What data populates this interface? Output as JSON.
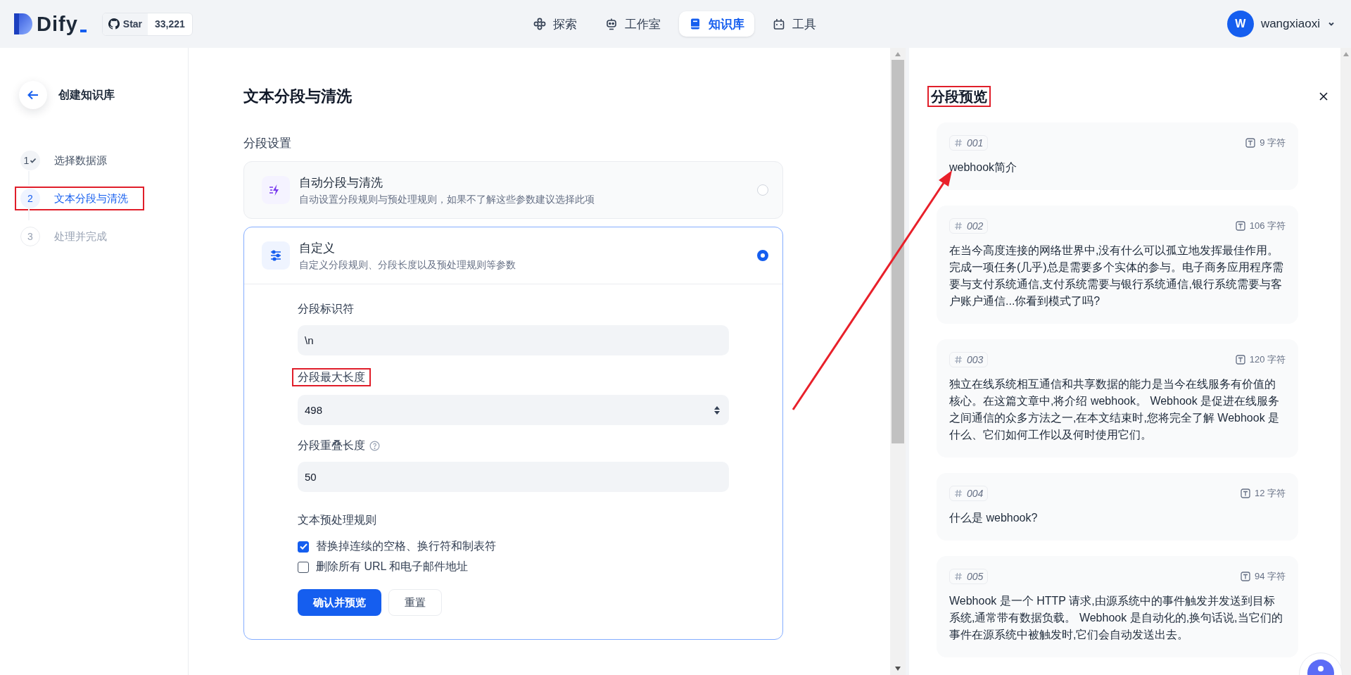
{
  "header": {
    "logo": "Dify",
    "github": {
      "label": "Star",
      "count": "33,221"
    },
    "nav": [
      {
        "kind": "explore",
        "label": "探索",
        "selected": false
      },
      {
        "kind": "studio",
        "label": "工作室",
        "selected": false
      },
      {
        "kind": "knowledge",
        "label": "知识库",
        "selected": true
      },
      {
        "kind": "tools",
        "label": "工具",
        "selected": false
      }
    ],
    "user": {
      "initial": "W",
      "name": "wangxiaoxi"
    }
  },
  "sidebar": {
    "title": "创建知识库",
    "steps": [
      {
        "number": "1",
        "label": "选择数据源",
        "done": true,
        "selected": false,
        "highlighted": false
      },
      {
        "number": "2",
        "label": "文本分段与清洗",
        "done": false,
        "selected": true,
        "highlighted": true
      },
      {
        "number": "3",
        "label": "处理并完成",
        "done": false,
        "selected": false,
        "highlighted": false
      }
    ]
  },
  "settings": {
    "title": "文本分段与清洗",
    "section": "分段设置",
    "modes": [
      {
        "kind": "auto",
        "title": "自动分段与清洗",
        "description": "自动设置分段规则与预处理规则，如果不了解这些参数建议选择此项",
        "selected": false,
        "expanded": false
      },
      {
        "kind": "custom",
        "title": "自定义",
        "description": "自定义分段规则、分段长度以及预处理规则等参数",
        "selected": true,
        "expanded": true,
        "fields": [
          {
            "kind": "text",
            "label": "分段标识符",
            "value": "\\n",
            "help": false,
            "highlighted": false
          },
          {
            "kind": "number",
            "label": "分段最大长度",
            "value": "498",
            "help": false,
            "highlighted": true
          },
          {
            "kind": "text",
            "label": "分段重叠长度",
            "value": "50",
            "help": true,
            "highlighted": false
          }
        ],
        "rules_title": "文本预处理规则",
        "rules": [
          {
            "label": "替换掉连续的空格、换行符和制表符",
            "checked": true
          },
          {
            "label": "删除所有 URL 和电子邮件地址",
            "checked": false
          }
        ],
        "buttons": [
          {
            "kind": "primary",
            "label": "确认并预览"
          },
          {
            "kind": "secondary",
            "label": "重置"
          }
        ]
      }
    ]
  },
  "preview": {
    "title": "分段预览",
    "highlighted": true,
    "chunks": [
      {
        "tag": "001",
        "count": "9 字符",
        "text": "webhook简介"
      },
      {
        "tag": "002",
        "count": "106 字符",
        "text": "在当今高度连接的网络世界中,没有什么可以孤立地发挥最佳作用。完成一项任务(几乎)总是需要多个实体的参与。电子商务应用程序需要与支付系统通信,支付系统需要与银行系统通信,银行系统需要与客户账户通信...你看到模式了吗?"
      },
      {
        "tag": "003",
        "count": "120 字符",
        "text": "独立在线系统相互通信和共享数据的能力是当今在线服务有价值的核心。在这篇文章中,将介绍 webhook。 Webhook 是促进在线服务之间通信的众多方法之一,在本文结束时,您将完全了解 Webhook 是什么、它们如何工作以及何时使用它们。"
      },
      {
        "tag": "004",
        "count": "12 字符",
        "text": "什么是 webhook?"
      },
      {
        "tag": "005",
        "count": "94 字符",
        "text": "Webhook 是一个 HTTP 请求,由源系统中的事件触发并发送到目标系统,通常带有数据负载。 Webhook 是自动化的,换句话说,当它们的事件在源系统中被触发时,它们会自动发送出去。"
      }
    ]
  },
  "arrow_annotation": true
}
